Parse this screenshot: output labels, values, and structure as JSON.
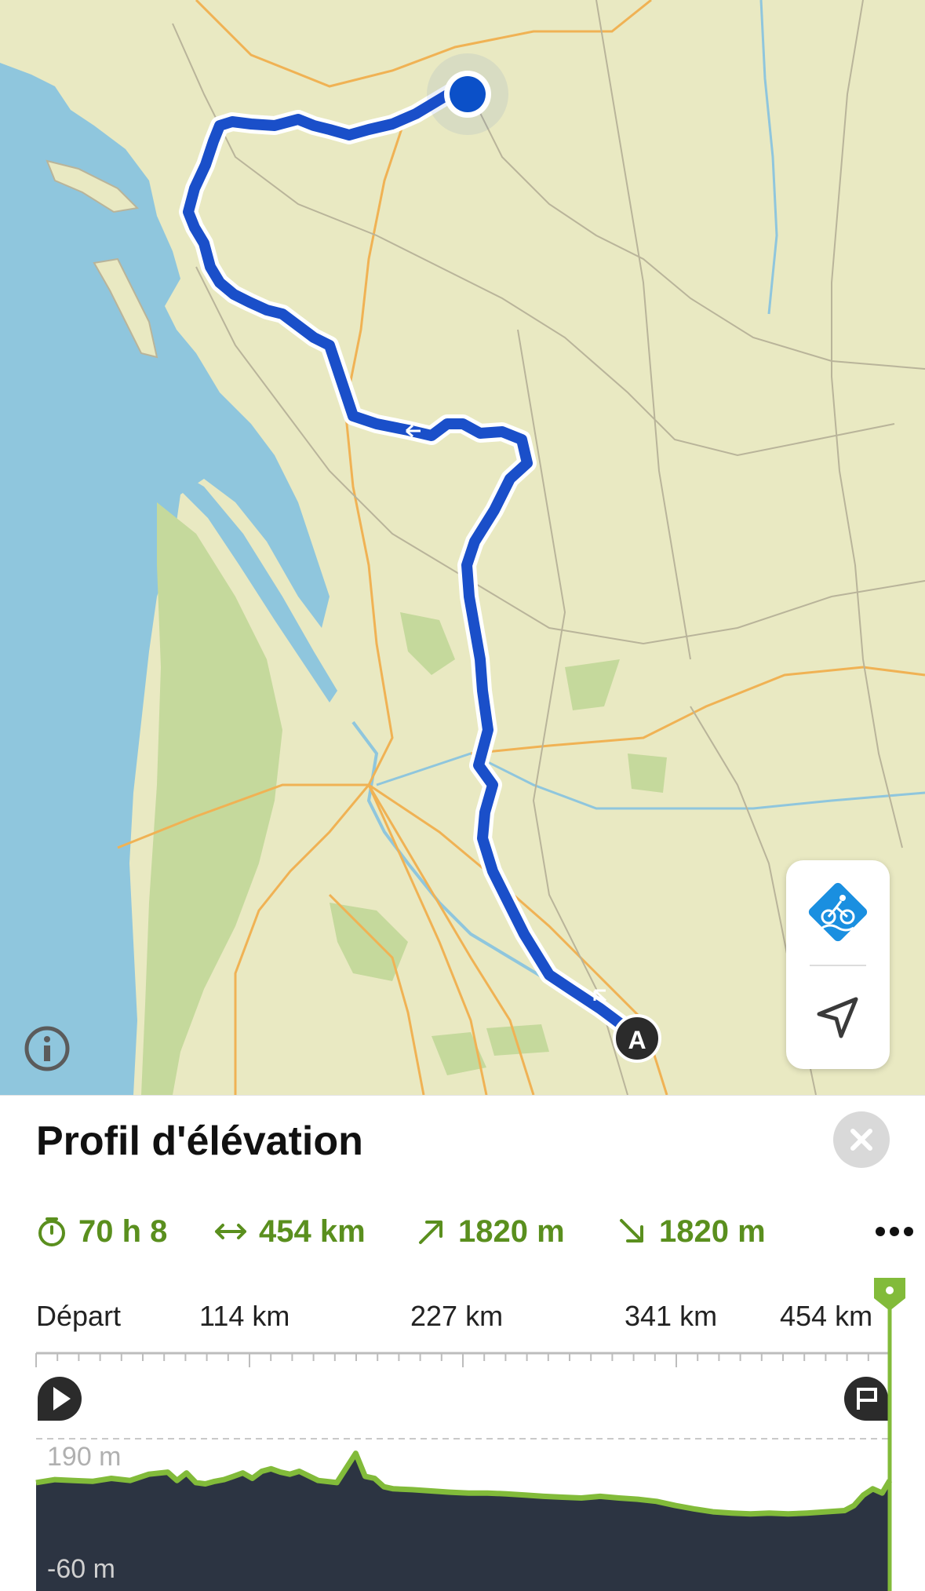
{
  "map": {
    "route_colors": {
      "route": "#1a4fc9",
      "route_outline": "#ffffff",
      "water": "#8fc6dd",
      "land": "#e9e9c2",
      "forest": "#c5d99c",
      "road": "#f0b254",
      "admin": "#b9b49a"
    },
    "start_marker": {
      "label": "A",
      "icon": "start-marker"
    },
    "position_marker": {
      "icon": "current-position-dot"
    },
    "controls": {
      "activity_icon": "cycling-icon",
      "locate_icon": "navigation-arrow-icon",
      "info_icon": "info-icon"
    }
  },
  "sheet": {
    "title": "Profil d'élévation",
    "close_icon": "close-icon",
    "stats": [
      {
        "icon": "stopwatch-icon",
        "value": "70 h 8"
      },
      {
        "icon": "distance-icon",
        "value": "454 km"
      },
      {
        "icon": "ascent-icon",
        "value": "1820 m"
      },
      {
        "icon": "descent-icon",
        "value": "1820 m"
      }
    ],
    "more_icon": "more-icon"
  },
  "chart_data": {
    "type": "area",
    "x_ticks": [
      "Départ",
      "114 km",
      "227 km",
      "341 km",
      "454 km"
    ],
    "xlim": [
      0,
      454
    ],
    "ylim": [
      -60,
      190
    ],
    "y_labels": [
      "190 m",
      "-60 m"
    ],
    "colors": {
      "line": "#82bb3a",
      "fill": "#2c3442",
      "marker": "#82bb3a"
    },
    "start_icon": "play-icon",
    "end_icon": "finish-flag-icon",
    "x": [
      0,
      10,
      20,
      30,
      40,
      50,
      60,
      70,
      75,
      80,
      85,
      90,
      95,
      100,
      105,
      110,
      115,
      120,
      125,
      130,
      135,
      140,
      150,
      160,
      170,
      175,
      180,
      185,
      190,
      200,
      210,
      220,
      230,
      240,
      250,
      260,
      270,
      280,
      290,
      300,
      310,
      320,
      330,
      340,
      350,
      360,
      370,
      380,
      390,
      400,
      410,
      420,
      430,
      435,
      440,
      445,
      450,
      454
    ],
    "y": [
      85,
      92,
      90,
      88,
      95,
      90,
      105,
      110,
      90,
      108,
      85,
      82,
      88,
      92,
      100,
      108,
      95,
      112,
      118,
      110,
      105,
      112,
      90,
      85,
      155,
      100,
      95,
      75,
      70,
      68,
      65,
      62,
      60,
      60,
      58,
      55,
      52,
      50,
      48,
      52,
      48,
      45,
      40,
      30,
      22,
      15,
      12,
      10,
      12,
      10,
      12,
      15,
      18,
      30,
      55,
      70,
      60,
      90
    ],
    "marker_x": 454
  }
}
